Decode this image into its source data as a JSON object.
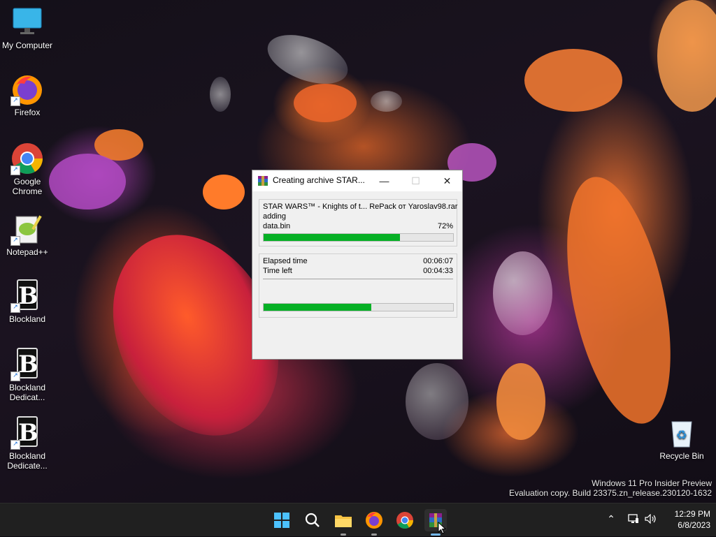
{
  "desktop": {
    "icons": [
      {
        "label": "My Computer",
        "icon": "monitor-icon"
      },
      {
        "label": "Firefox",
        "icon": "firefox-icon"
      },
      {
        "label": "Google Chrome",
        "icon": "chrome-icon"
      },
      {
        "label": "Notepad++",
        "icon": "notepadpp-icon"
      },
      {
        "label": "Blockland",
        "icon": "blockland-icon"
      },
      {
        "label": "Blockland Dedicat...",
        "icon": "blockland-icon"
      },
      {
        "label": "Blockland Dedicate...",
        "icon": "blockland-icon"
      },
      {
        "label": "Recycle Bin",
        "icon": "recycle-bin-icon"
      }
    ],
    "watermark": {
      "line1": "Windows 11 Pro Insider Preview",
      "line2": "Evaluation copy. Build 23375.zn_release.230120-1632"
    }
  },
  "dialog": {
    "title": "Creating archive STAR...",
    "archive_name": "STAR WARS™ - Knights of t... RePack от Yaroslav98.rar",
    "action": "adding",
    "current_file": "data.bin",
    "file_percent_label": "72%",
    "file_progress": 0.72,
    "elapsed_label": "Elapsed time",
    "elapsed_value": "00:06:07",
    "time_left_label": "Time left",
    "time_left_value": "00:04:33",
    "total_progress": 0.57
  },
  "taskbar": {
    "apps": [
      "start-icon",
      "search-icon",
      "file-explorer-icon",
      "firefox-icon",
      "chrome-icon",
      "winrar-icon"
    ],
    "clock_time": "12:29 PM",
    "clock_date": "6/8/2023"
  },
  "colors": {
    "progress_fill": "#06b025",
    "taskbar_bg": "#202020"
  }
}
